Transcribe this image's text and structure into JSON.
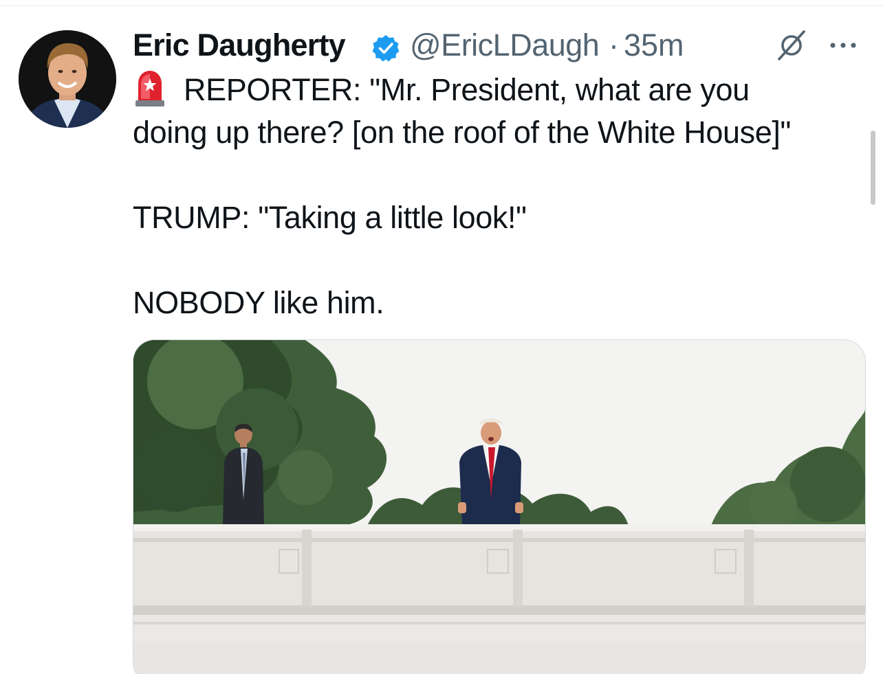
{
  "tweet": {
    "author": {
      "display_name": "Eric Daugherty",
      "verified": true,
      "handle": "@EricLDaugh",
      "separator": "·",
      "timestamp": "35m"
    },
    "text_lines": [
      "REPORTER: \"Mr. President, what are you",
      "doing up there? [on the roof of the White House]\"",
      "TRUMP: \"Taking a little look!\"",
      "NOBODY like him."
    ],
    "lead_emoji": "siren-icon",
    "media": {
      "type": "video-still",
      "icon": "image"
    }
  },
  "icons": {
    "verified": "verified-badge-icon",
    "grok": "grok-icon",
    "more": "more-icon"
  },
  "colors": {
    "text_primary": "#0f1419",
    "text_secondary": "#536471",
    "verified_blue": "#1d9bf0",
    "siren_red": "#e0222f",
    "border": "#cfd9de"
  }
}
